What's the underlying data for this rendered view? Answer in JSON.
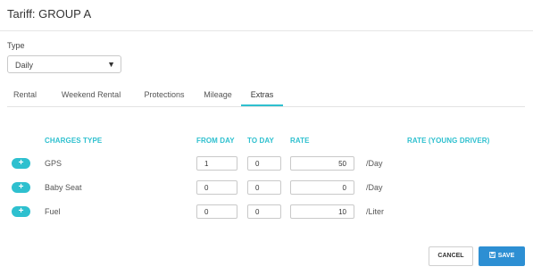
{
  "dialog": {
    "title": "Tariff: GROUP A"
  },
  "type_field": {
    "label": "Type",
    "selected": "Daily"
  },
  "tabs": [
    {
      "label": "Rental",
      "active": false
    },
    {
      "label": "Weekend Rental",
      "active": false
    },
    {
      "label": "Protections",
      "active": false
    },
    {
      "label": "Mileage",
      "active": false
    },
    {
      "label": "Extras",
      "active": true
    }
  ],
  "table": {
    "headers": {
      "charges_type": "CHARGES TYPE",
      "from_day": "FROM DAY",
      "to_day": "TO DAY",
      "rate": "RATE",
      "rate_young": "RATE (YOUNG DRIVER)"
    },
    "rows": [
      {
        "add": "+",
        "name": "GPS",
        "from_day": "1",
        "to_day": "0",
        "rate": "50",
        "unit": "/Day"
      },
      {
        "add": "+",
        "name": "Baby Seat",
        "from_day": "0",
        "to_day": "0",
        "rate": "0",
        "unit": "/Day"
      },
      {
        "add": "+",
        "name": "Fuel",
        "from_day": "0",
        "to_day": "0",
        "rate": "10",
        "unit": "/Liter"
      }
    ]
  },
  "actions": {
    "cancel": "CANCEL",
    "save": "SAVE"
  },
  "colors": {
    "accent": "#2ec0cf",
    "primary": "#2d8fd3"
  },
  "icons": {
    "select_caret": "caret-down-icon",
    "add": "plus-icon",
    "save": "floppy-disk-icon"
  }
}
